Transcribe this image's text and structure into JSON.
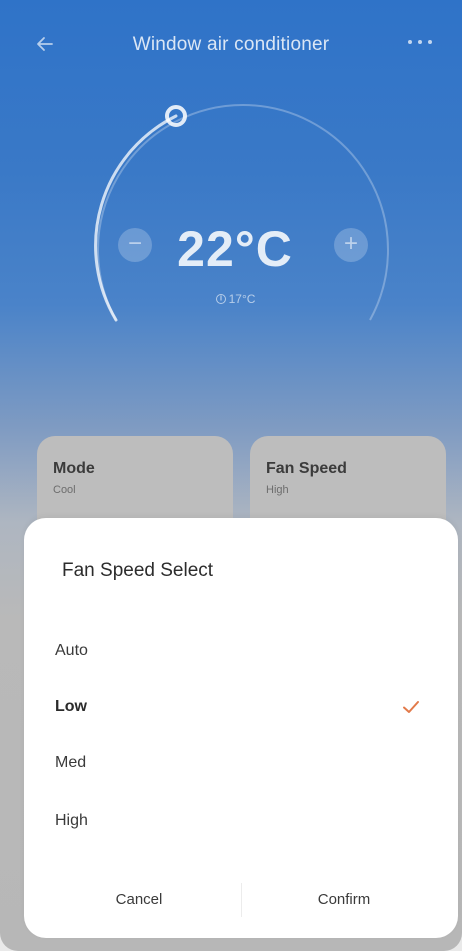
{
  "header": {
    "title": "Window air conditioner",
    "back_icon": "arrow-left-icon",
    "more_icon": "more-horizontal-icon"
  },
  "dial": {
    "temperature": "22°C",
    "room_temperature": "17°C",
    "room_icon": "room-thermometer-icon",
    "minus_label": "−",
    "plus_label": "+"
  },
  "cards": {
    "mode": {
      "label": "Mode",
      "value": "Cool"
    },
    "fan_speed": {
      "label": "Fan Speed",
      "value": "High"
    }
  },
  "sheet": {
    "title": "Fan Speed Select",
    "options": [
      {
        "label": "Auto",
        "selected": false
      },
      {
        "label": "Low",
        "selected": true
      },
      {
        "label": "Med",
        "selected": false
      },
      {
        "label": "High",
        "selected": false
      }
    ],
    "cancel_label": "Cancel",
    "confirm_label": "Confirm"
  },
  "colors": {
    "accent": "#e27a4a",
    "header_blue": "#2f73c8",
    "sheet_bg": "#ffffff"
  }
}
